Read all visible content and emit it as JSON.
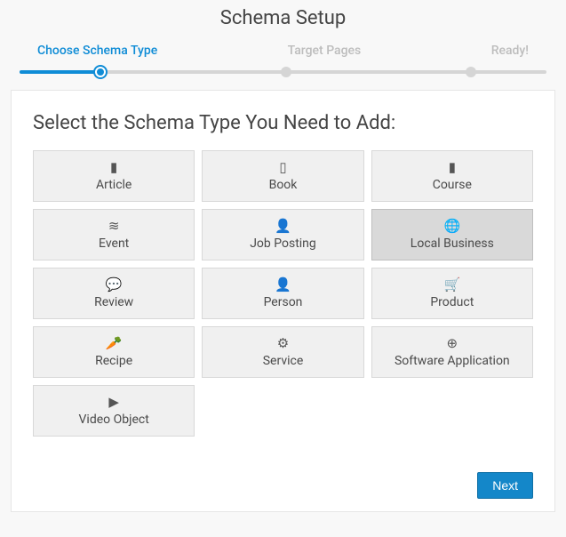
{
  "page_title": "Schema Setup",
  "stepper": {
    "steps": [
      {
        "label": "Choose Schema Type",
        "active": true
      },
      {
        "label": "Target Pages",
        "active": false
      },
      {
        "label": "Ready!",
        "active": false
      }
    ]
  },
  "panel": {
    "heading": "Select the Schema Type You Need to Add:",
    "tiles": [
      {
        "icon": "file-icon",
        "glyph": "▮",
        "label": "Article",
        "selected": false
      },
      {
        "icon": "book-icon",
        "glyph": "▯",
        "label": "Book",
        "selected": false
      },
      {
        "icon": "course-icon",
        "glyph": "▮",
        "label": "Course",
        "selected": false
      },
      {
        "icon": "event-icon",
        "glyph": "≋",
        "label": "Event",
        "selected": false
      },
      {
        "icon": "job-icon",
        "glyph": "👤",
        "label": "Job Posting",
        "selected": false
      },
      {
        "icon": "globe-icon",
        "glyph": "🌐",
        "label": "Local Business",
        "selected": true
      },
      {
        "icon": "review-icon",
        "glyph": "💬",
        "label": "Review",
        "selected": false
      },
      {
        "icon": "person-icon",
        "glyph": "👤",
        "label": "Person",
        "selected": false
      },
      {
        "icon": "product-icon",
        "glyph": "🛒",
        "label": "Product",
        "selected": false
      },
      {
        "icon": "recipe-icon",
        "glyph": "🥕",
        "label": "Recipe",
        "selected": false
      },
      {
        "icon": "service-icon",
        "glyph": "⚙",
        "label": "Service",
        "selected": false
      },
      {
        "icon": "software-icon",
        "glyph": "⊕",
        "label": "Software Application",
        "selected": false
      },
      {
        "icon": "video-icon",
        "glyph": "▶",
        "label": "Video Object",
        "selected": false
      }
    ]
  },
  "footer": {
    "next_label": "Next"
  }
}
